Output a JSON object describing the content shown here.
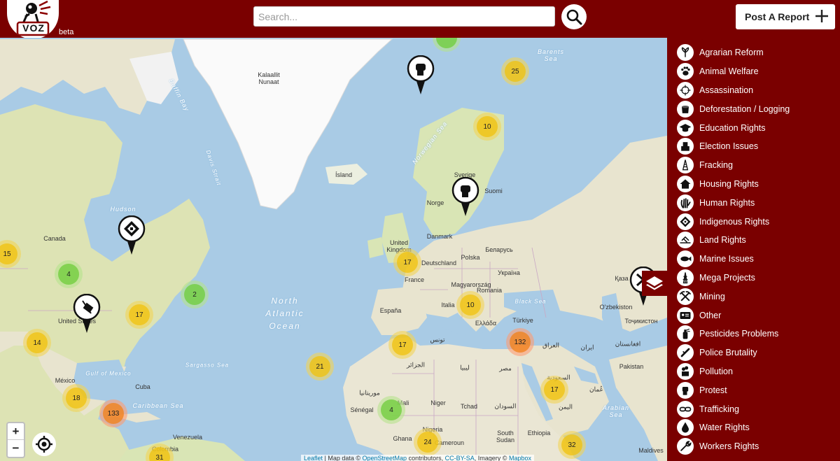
{
  "header": {
    "logo_text": "VOZ",
    "beta": "beta",
    "search_placeholder": "Search...",
    "post_report": "Post A Report",
    "post_report_icon": "plus-icon",
    "search_icon": "magnifier-icon"
  },
  "colors": {
    "brand": "#7a0000",
    "cluster_small": "#6ecc39",
    "cluster_medium": "#f0c20c",
    "cluster_large": "#f18017",
    "water": "#a9cbe5",
    "land": "#e8e4cf"
  },
  "map": {
    "labels": {
      "greenland": "Kalaallit\nNunaat",
      "baffin_bay": "Baffin Bay",
      "davis_strait": "Davis Strait",
      "hudson": "Hudson",
      "canada": "Canada",
      "united_states": "United States",
      "mexico": "México",
      "cuba": "Cuba",
      "gulf_of_mexico": "Gulf of Mexico",
      "caribbean": "Caribbean Sea",
      "sargasso": "Sargasso Sea",
      "north_atlantic": "North\nAtlantic\nOcean",
      "venezuela": "Venezuela",
      "colombia": "Colombia",
      "island": "Ísland",
      "norwegian_sea": "Norwegian Sea",
      "barents": "Barents\nSea",
      "sverige": "Sverige",
      "suomi": "Suomi",
      "norge": "Norge",
      "danmark": "Danmark",
      "uk": "United\nKingdom",
      "deutschland": "Deutschland",
      "polska": "Polska",
      "belarus": "Беларусь",
      "ukraina": "Україна",
      "france": "France",
      "espana": "España",
      "italia": "Italia",
      "magyarorszag": "Magyarország",
      "romania": "Romania",
      "black_sea": "Black Sea",
      "turkiye": "Türkiye",
      "ellada": "Ελλάδα",
      "tunis": "تونس",
      "jazair": "الجزائر",
      "libya": "ليبيا",
      "misr": "مصر",
      "iraq": "العراق",
      "iran": "ایران",
      "afghanistan": "افغانستان",
      "pakistan": "Pakistan",
      "uzbekistan": "O'zbekiston",
      "tojikiston": "Тоҷикистон",
      "kazakhstan": "Қаза",
      "mauritania": "موريتانيا",
      "mali": "Mali",
      "niger": "Niger",
      "tchad": "Tchad",
      "sudan": "السودان",
      "senegal": "Sénégal",
      "nigeria": "Nigeria",
      "ghana": "Ghana",
      "cameroun": "Cameroun",
      "south_sudan": "South\nSudan",
      "ethiopia": "Ethiopia",
      "saudi": "السعودية",
      "yemen": "اليمن",
      "oman": "عُمان",
      "arabian_sea": "Arabian\nSea",
      "maldives": "Maldives"
    },
    "clusters": [
      {
        "count": "15",
        "size": "medium"
      },
      {
        "count": "4",
        "size": "small"
      },
      {
        "count": "2",
        "size": "small"
      },
      {
        "count": "17",
        "size": "medium"
      },
      {
        "count": "14",
        "size": "medium"
      },
      {
        "count": "18",
        "size": "medium"
      },
      {
        "count": "133",
        "size": "large"
      },
      {
        "count": "31",
        "size": "medium"
      },
      {
        "count": "21",
        "size": "medium"
      },
      {
        "count": "25",
        "size": "medium"
      },
      {
        "count": "10",
        "size": "medium"
      },
      {
        "count": "17",
        "size": "medium"
      },
      {
        "count": "10",
        "size": "medium"
      },
      {
        "count": "132",
        "size": "large"
      },
      {
        "count": "17",
        "size": "medium"
      },
      {
        "count": "17",
        "size": "medium"
      },
      {
        "count": "4",
        "size": "small"
      },
      {
        "count": "24",
        "size": "medium"
      },
      {
        "count": "32",
        "size": "medium"
      },
      {
        "count": "",
        "size": "small"
      }
    ],
    "pins": [
      {
        "icon": "fist-icon"
      },
      {
        "icon": "indigenous-rights-icon"
      },
      {
        "icon": "fracking-icon"
      },
      {
        "icon": "fist-icon"
      },
      {
        "icon": "mining-icon"
      }
    ],
    "zoom_in": "+",
    "zoom_out": "−",
    "attribution": {
      "leaflet": "Leaflet",
      "text1": " | Map data © ",
      "osm": "OpenStreetMap",
      "text2": " contributors, ",
      "license": "CC-BY-SA",
      "text3": ", Imagery © ",
      "mapbox": "Mapbox"
    }
  },
  "categories": [
    {
      "label": "Agrarian Reform",
      "icon": "plant-icon"
    },
    {
      "label": "Animal Welfare",
      "icon": "paw-icon"
    },
    {
      "label": "Assassination",
      "icon": "crosshair-icon"
    },
    {
      "label": "Deforestation / Logging",
      "icon": "stump-icon"
    },
    {
      "label": "Education Rights",
      "icon": "graduation-cap-icon"
    },
    {
      "label": "Election Issues",
      "icon": "ballot-icon"
    },
    {
      "label": "Fracking",
      "icon": "drill-icon"
    },
    {
      "label": "Housing Rights",
      "icon": "house-icon"
    },
    {
      "label": "Human Rights",
      "icon": "hand-icon"
    },
    {
      "label": "Indigenous Rights",
      "icon": "diamond-pattern-icon"
    },
    {
      "label": "Land Rights",
      "icon": "land-icon"
    },
    {
      "label": "Marine Issues",
      "icon": "fish-icon"
    },
    {
      "label": "Mega Projects",
      "icon": "tower-icon"
    },
    {
      "label": "Mining",
      "icon": "pickaxes-icon"
    },
    {
      "label": "Other",
      "icon": "id-card-icon"
    },
    {
      "label": "Pesticides Problems",
      "icon": "sprayer-icon"
    },
    {
      "label": "Police Brutality",
      "icon": "baton-icon"
    },
    {
      "label": "Pollution",
      "icon": "smoke-icon"
    },
    {
      "label": "Protest",
      "icon": "fist-icon"
    },
    {
      "label": "Trafficking",
      "icon": "chain-icon"
    },
    {
      "label": "Water Rights",
      "icon": "drop-icon"
    },
    {
      "label": "Workers Rights",
      "icon": "wrench-icon"
    }
  ]
}
